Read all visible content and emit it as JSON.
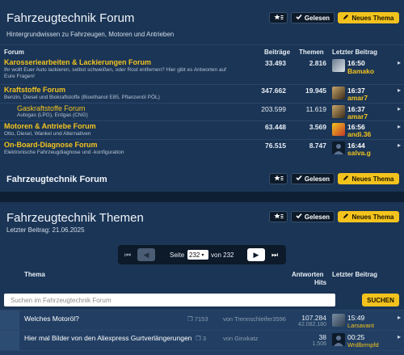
{
  "forum_panel": {
    "title": "Fahrzeugtechnik Forum",
    "subtitle": "Hintergrundwissen zu Fahrzeugen, Motoren und Antrieben",
    "btn_read": "Gelesen",
    "btn_new": "Neues Thema",
    "columns": {
      "forum": "Forum",
      "posts": "Beiträge",
      "topics": "Themen",
      "last": "Letzter Beitrag"
    },
    "forums": [
      {
        "name": "Karosseriearbeiten & Lackierungen Forum",
        "desc": "Ihr wollt Euer Auto lackieren, selbst schweißen, oder Rost entfernen? Hier gibt es Antworten auf",
        "desc2": "Eure Fragen!",
        "posts": "33.493",
        "topics": "2.816",
        "time": "16:50",
        "user": "Bamako"
      },
      {
        "name": "Kraftstoffe Forum",
        "desc": "Benzin, Diesel und Biokraftstoffe (Bioethanol E85, Pflanzenöl PÖL)",
        "posts": "347.662",
        "topics": "19.945",
        "time": "16:37",
        "user": "amar7"
      },
      {
        "name": "Gaskraftstoffe Forum",
        "desc": "Autogas (LPG), Erdgas (CNG)",
        "posts": "203.599",
        "topics": "11.619",
        "time": "16:37",
        "user": "amar7"
      },
      {
        "name": "Motoren & Antriebe Forum",
        "desc": "Otto, Diesel, Wankel und Alternativen",
        "posts": "63.448",
        "topics": "3.569",
        "time": "16:56",
        "user": "andi.36"
      },
      {
        "name": "On-Board-Diagnose Forum",
        "desc": "Elektronische Fahrzeugdiagnose und -konfiguration",
        "posts": "76.515",
        "topics": "8.747",
        "time": "16:44",
        "user": "salva.g"
      }
    ],
    "footer_title": "Fahrzeugtechnik Forum"
  },
  "topics_panel": {
    "title": "Fahrzeugtechnik Themen",
    "last_post": "Letzter Beitrag: 21.06.2025",
    "btn_read": "Gelesen",
    "btn_new": "Neues Thema",
    "pager": {
      "page_label": "Seite",
      "current": "232",
      "of_label": "von 232"
    },
    "columns": {
      "topic": "Thema",
      "answers": "Antworten",
      "hits": "Hits",
      "last": "Letzter Beitrag"
    },
    "search_placeholder": "Suchen im Fahrzeugtechnik Forum",
    "search_button": "SUCHEN",
    "topics": [
      {
        "title": "Welches Motoröl?",
        "pages": "7153",
        "by": "von Trennschleifer3596",
        "answers": "107.284",
        "hits": "42.082.180",
        "time": "15:49",
        "user": "Larsavant"
      },
      {
        "title": "Hier mal Bilder von den Aliexpress Gurtverlängerungen",
        "pages": "3",
        "by": "von Ginxkatz",
        "answers": "38",
        "hits": "1.506",
        "time": "00:25",
        "user": "Wrdlbrmpfd"
      }
    ]
  }
}
